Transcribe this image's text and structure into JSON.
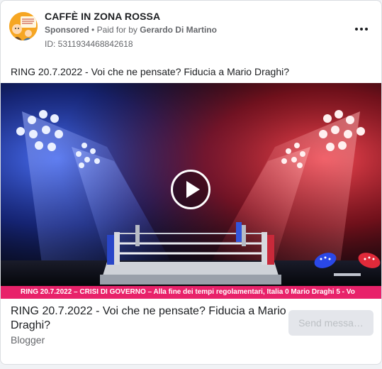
{
  "ad": {
    "page_name": "CAFFÈ IN ZONA ROSSA",
    "sponsored_label": "Sponsored",
    "separator": "•",
    "paid_for_label": "Paid for by",
    "paid_for_by": "Gerardo Di Martino",
    "ad_id": "ID: 5311934468842618",
    "caption": "RING 20.7.2022 - Voi che ne pensate? Fiducia a Mario Draghi?",
    "more_icon": "ellipsis-icon",
    "avatar_icon": "page-avatar-logo"
  },
  "video": {
    "ticker_text": "RING 20.7.2022 – CRISI DI GOVERNO – Alla fine dei tempi regolamentari, Italia 0 Mario Draghi 5 - Vo",
    "play_icon": "play-icon",
    "colors": {
      "left_light": "#2f5bff",
      "right_light": "#ff2a3a",
      "ticker": "#e8226a"
    }
  },
  "link": {
    "title": "RING 20.7.2022 - Voi che ne pensate? Fiducia a Mario Draghi?",
    "source": "Blogger",
    "cta_label": "Send messa…"
  }
}
